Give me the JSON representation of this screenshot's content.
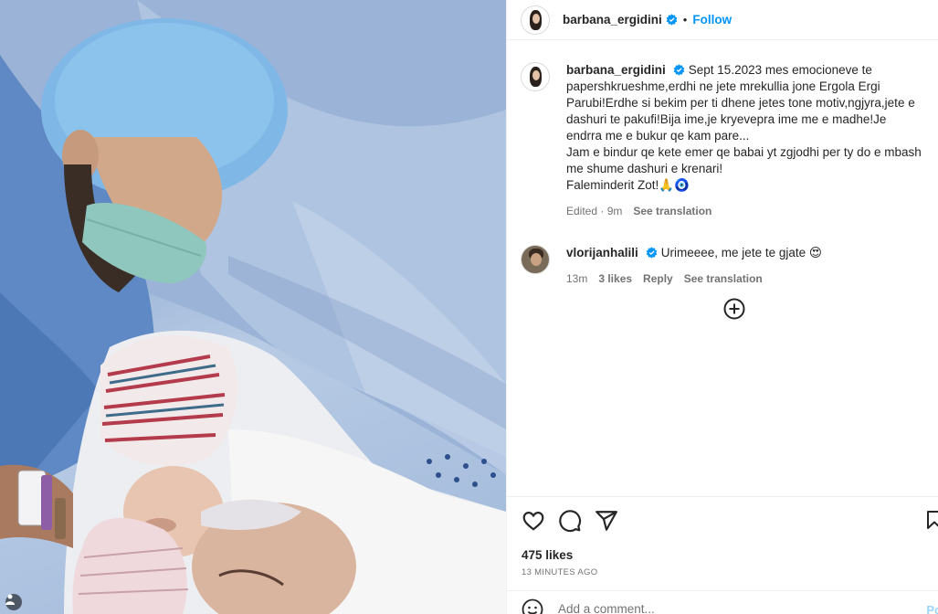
{
  "header": {
    "username": "barbana_ergidini",
    "follow_label": "Follow",
    "dot": "•"
  },
  "caption": {
    "username": "barbana_ergidini",
    "text": "Sept 15.2023 mes emocioneve te papershkrueshme,erdhi ne jete mrekullia jone Ergola Ergi Parubi!Erdhe si bekim per ti dhene jetes tone motiv,ngjyra,jete e dashuri te pakufi!Bija ime,je kryevepra ime me e madhe!Je endrra me e bukur qe kam pare...\nJam e bindur qe kete emer qe babai yt zgjodhi per ty do e mbash me shume dashuri e krenari!\nFaleminderit Zot!🙏🧿",
    "edited": "Edited · 9m",
    "see_translation": "See translation"
  },
  "comment": {
    "username": "vlorijanhalili",
    "text": "Urimeeee, me jete te gjate 😍",
    "time": "13m",
    "likes": "3 likes",
    "reply": "Reply",
    "see_translation": "See translation"
  },
  "icons": {
    "verified": "verified-badge-icon",
    "load_more": "plus-circle-icon",
    "like": "heart-icon",
    "comment": "comment-bubble-icon",
    "share": "paper-plane-icon",
    "save": "bookmark-icon",
    "emoji": "smiley-icon"
  },
  "stats": {
    "likes": "475 likes",
    "time_ago": "13 MINUTES AGO"
  },
  "add_comment": {
    "placeholder": "Add a comment...",
    "post_label": "Po"
  },
  "colors": {
    "accent": "#0095f6",
    "verified": "#0095f6",
    "text": "#262626",
    "muted": "#737373"
  }
}
